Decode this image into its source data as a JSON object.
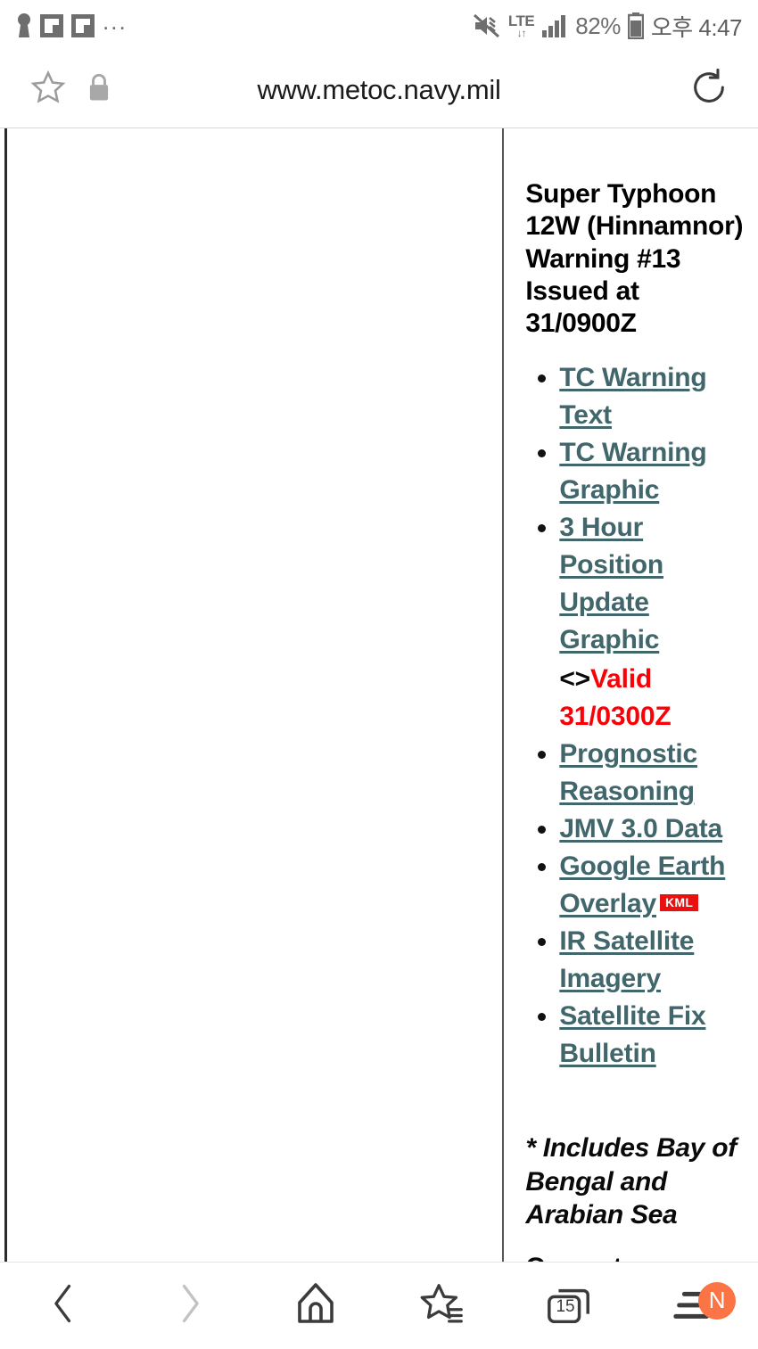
{
  "status_bar": {
    "left_icons": [
      "keyhole-icon",
      "flipboard-icon",
      "flipboard-icon"
    ],
    "overflow": "...",
    "network": "LTE",
    "network_arrows": "↓↑",
    "battery_percent": "82%",
    "time": "오후 4:47"
  },
  "browser": {
    "url": "www.metoc.navy.mil",
    "bookmark_icon": "star-icon",
    "secure_icon": "lock-icon",
    "reload_icon": "reload-icon"
  },
  "page": {
    "title": "Super Typhoon 12W (Hinnamnor) Warning #13 Issued at 31/0900Z",
    "links": [
      {
        "label": "TC Warning Text"
      },
      {
        "label": "TC Warning Graphic"
      },
      {
        "label": "3 Hour Position Update Graphic"
      },
      {
        "label": "Prognostic Reasoning"
      },
      {
        "label": "JMV 3.0 Data"
      },
      {
        "label": "Google Earth Overlay",
        "badge": "KML"
      },
      {
        "label": "IR Satellite Imagery"
      },
      {
        "label": "Satellite Fix Bulletin"
      }
    ],
    "valid_brackets": "<>",
    "valid_text": "Valid 31/0300Z",
    "footnote": "* Includes Bay of Bengal and Arabian Sea",
    "clipped_text": "Current"
  },
  "bottom_nav": {
    "back": "back-icon",
    "forward": "forward-icon",
    "home": "home-icon",
    "bookmarks": "bookmarks-icon",
    "tabs_count": "15",
    "menu": "menu-icon",
    "menu_badge": "N"
  },
  "colors": {
    "link": "#41666b",
    "alert_red": "#fb0007",
    "kml_badge": "#e8110f",
    "badge_orange": "#fb7445"
  }
}
